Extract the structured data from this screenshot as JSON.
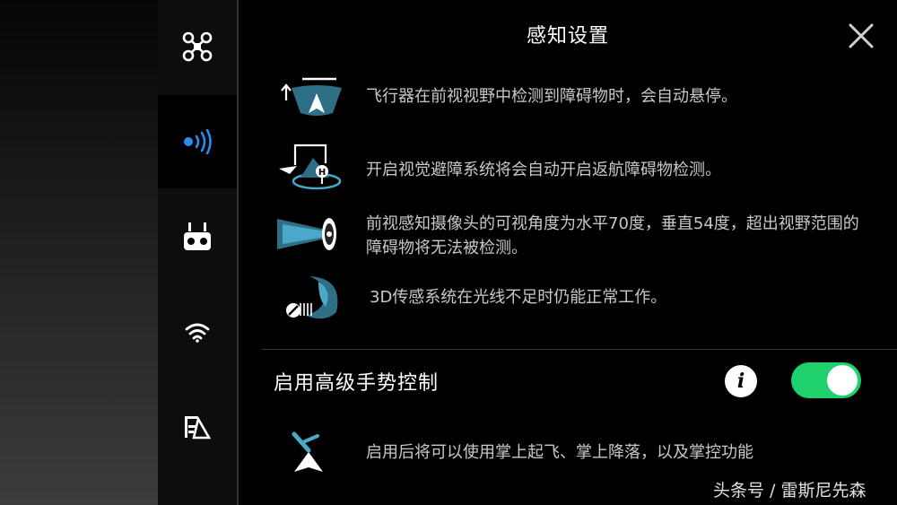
{
  "header": {
    "title": "感知设置"
  },
  "sidebar": {
    "items": [
      {
        "icon": "drone-icon"
      },
      {
        "icon": "sensor-signal-icon",
        "active": true
      },
      {
        "icon": "remote-controller-icon"
      },
      {
        "icon": "wifi-icon"
      },
      {
        "icon": "image-transmission-icon"
      }
    ]
  },
  "info": {
    "items": [
      {
        "icon": "forward-detect-hover-icon",
        "text": "飞行器在前视视野中检测到障碍物时，会自动悬停。"
      },
      {
        "icon": "return-home-detect-icon",
        "text": "开启视觉避障系统将会自动开启返航障碍物检测。"
      },
      {
        "icon": "forward-camera-fov-icon",
        "text": "前视感知摄像头的可视角度为水平70度，垂直54度，超出视野范围的障碍物将无法被检测。"
      },
      {
        "icon": "3d-sensor-icon",
        "text": "3D传感系统在光线不足时仍能正常工作。"
      }
    ]
  },
  "gesture": {
    "label": "启用高级手势控制",
    "info_button": "i",
    "toggle_on": true,
    "description": "启用后将可以使用掌上起飞、掌上降落，以及掌控功能"
  },
  "colors": {
    "toggle_on": "#1fd16d",
    "active_icon": "#2b8cf0",
    "icon_teal": "#4aa9c8"
  },
  "watermark": "头条号 / 雷斯尼先森"
}
